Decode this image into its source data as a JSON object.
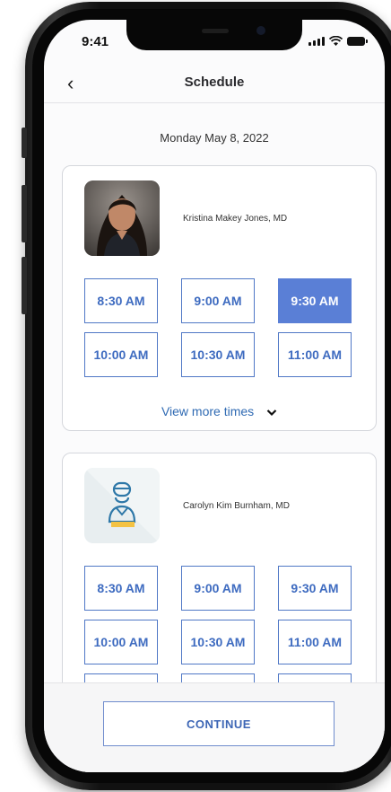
{
  "status_bar": {
    "time": "9:41"
  },
  "header": {
    "title": "Schedule",
    "back_icon": "chevron-left-icon"
  },
  "date": "Monday May 8, 2022",
  "doctors": [
    {
      "name": "Kristina Makey Jones, MD",
      "slots": [
        "8:30 AM",
        "9:00 AM",
        "9:30 AM",
        "10:00 AM",
        "10:30 AM",
        "11:00 AM"
      ],
      "selected_slot": "9:30 AM",
      "view_more_label": "View more times"
    },
    {
      "name": "Carolyn Kim Burnham, MD",
      "avatar_icon": "doctor-placeholder-icon",
      "slots": [
        "8:30 AM",
        "9:00 AM",
        "9:30 AM",
        "10:00 AM",
        "10:30 AM",
        "11:00 AM"
      ]
    }
  ],
  "footer": {
    "continue_label": "CONTINUE"
  },
  "colors": {
    "accent": "#5a7fd6",
    "slot_border": "#5078c6",
    "link": "#2f6ab3"
  }
}
